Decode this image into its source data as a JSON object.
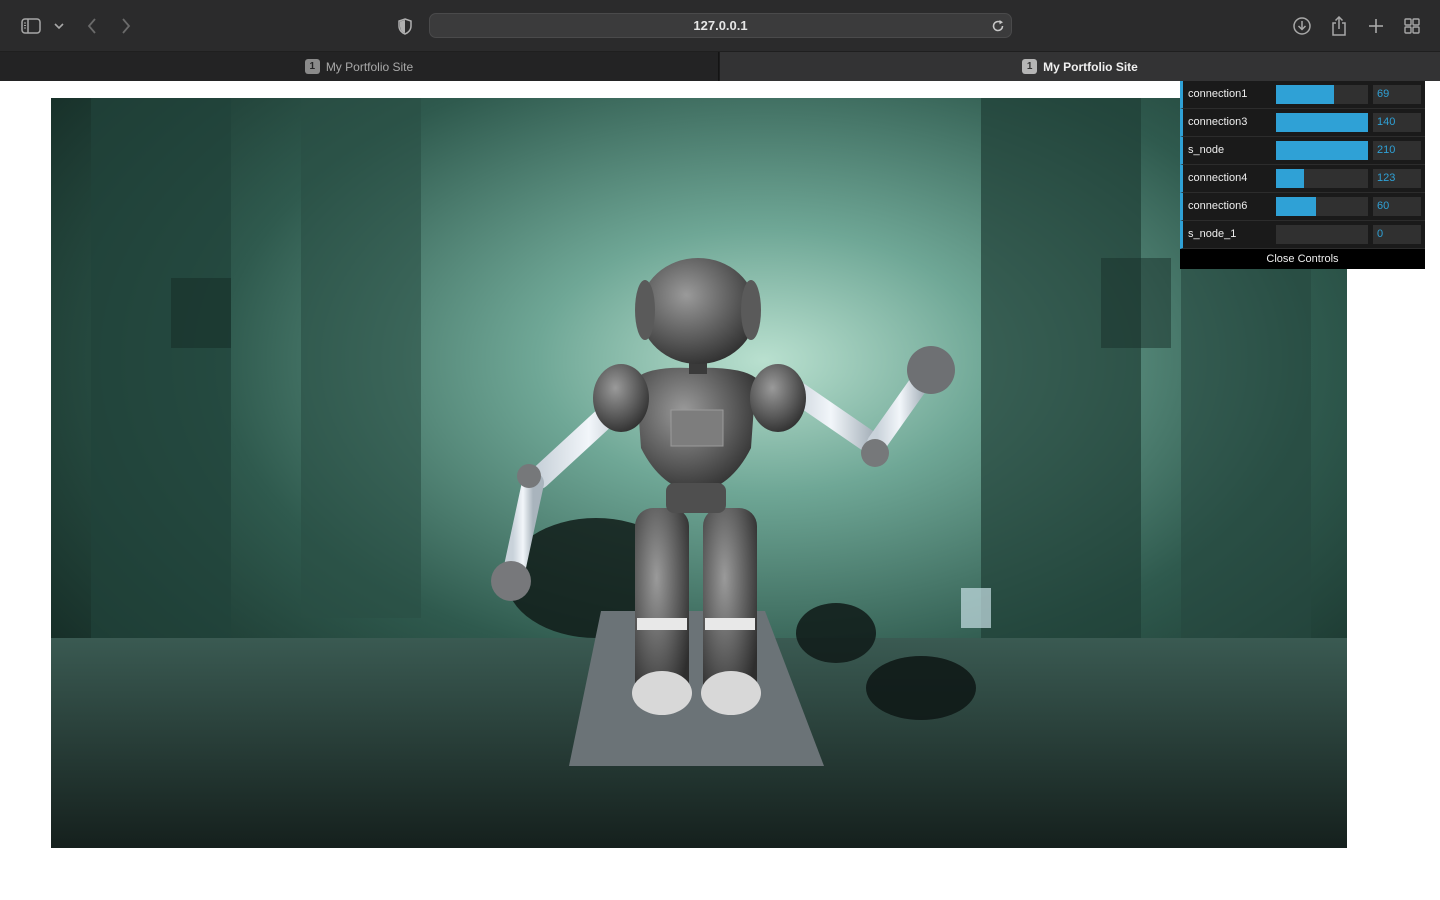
{
  "browser": {
    "url": "127.0.0.1",
    "tabs": [
      {
        "badge": "1",
        "title": "My Portfolio Site",
        "active": false
      },
      {
        "badge": "1",
        "title": "My Portfolio Site",
        "active": true
      }
    ]
  },
  "controls": {
    "accent": "#2fa1d6",
    "rows": [
      {
        "label": "connection1",
        "value": "69",
        "fraction": 0.63
      },
      {
        "label": "connection3",
        "value": "140",
        "fraction": 1.0
      },
      {
        "label": "s_node",
        "value": "210",
        "fraction": 1.0
      },
      {
        "label": "connection4",
        "value": "123",
        "fraction": 0.3
      },
      {
        "label": "connection6",
        "value": "60",
        "fraction": 0.43
      },
      {
        "label": "s_node_1",
        "value": "0",
        "fraction": 0.0
      }
    ],
    "close_label": "Close Controls"
  }
}
